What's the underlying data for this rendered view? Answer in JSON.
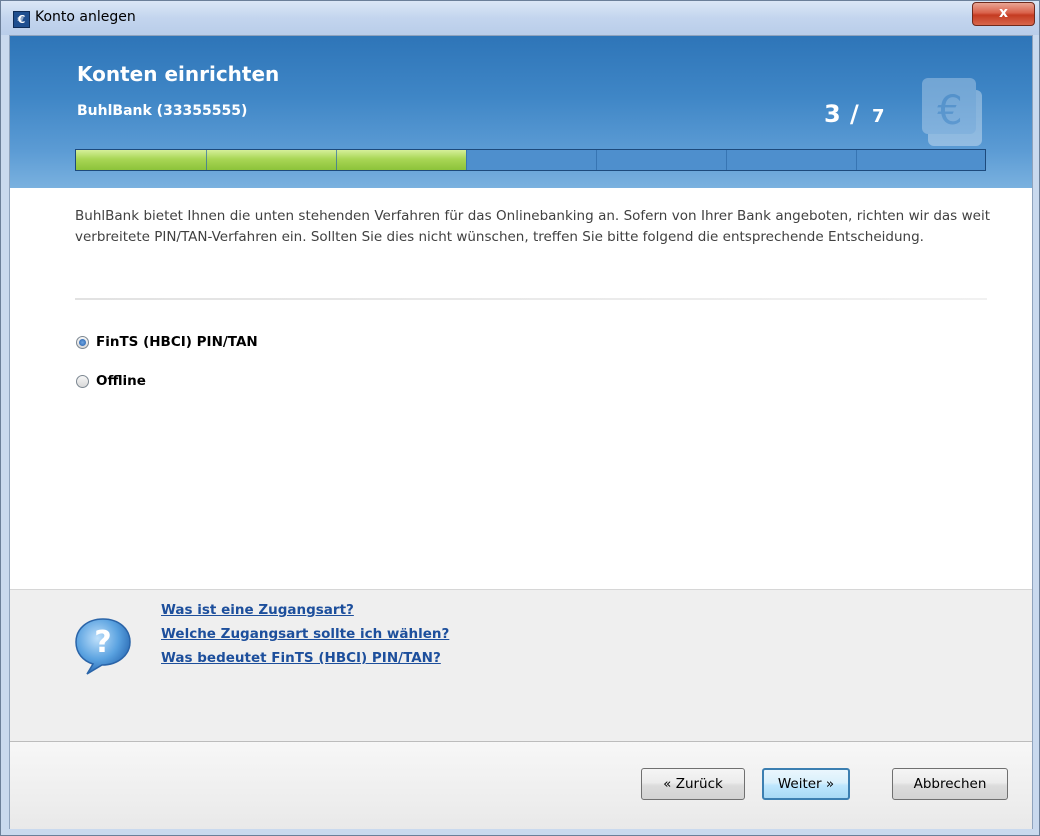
{
  "window": {
    "title": "Konto anlegen",
    "close_label": "x",
    "app_icon": "euro-icon"
  },
  "header": {
    "title": "Konten einrichten",
    "subtitle": "BuhlBank (33355555)",
    "step_current": "3",
    "step_separator": "/",
    "step_total": "7",
    "progress": {
      "completed_steps": 3,
      "total_steps": 7
    },
    "watermark_icon": "euro-icon"
  },
  "description": "BuhlBank bietet Ihnen die unten stehenden Verfahren für das Onlinebanking an. Sofern von Ihrer Bank angeboten, richten wir das weit verbreitete PIN/TAN-Verfahren ein. Sollten Sie dies nicht wünschen, treffen Sie bitte folgend die entsprechende Entscheidung.",
  "options": [
    {
      "label": "FinTS (HBCI) PIN/TAN",
      "selected": true
    },
    {
      "label": "Offline",
      "selected": false
    }
  ],
  "help": {
    "icon": "question-bubble-icon",
    "links": [
      "Was ist eine Zugangsart?",
      "Welche Zugangsart sollte ich wählen?",
      "Was bedeutet FinTS (HBCI) PIN/TAN?"
    ]
  },
  "buttons": {
    "back": "« Zurück",
    "next": "Weiter »",
    "cancel": "Abbrechen"
  },
  "colors": {
    "header_blue": "#3f86c6",
    "progress_green": "#a9d655",
    "link_blue": "#1d4f9c"
  }
}
